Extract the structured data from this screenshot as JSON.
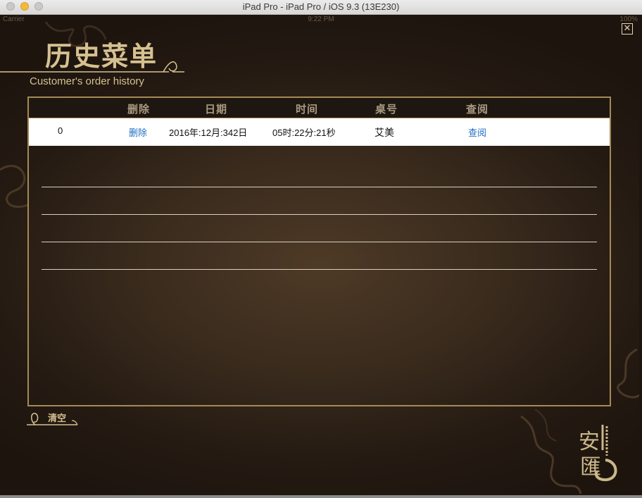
{
  "window": {
    "title": "iPad Pro - iPad Pro / iOS 9.3 (13E230)"
  },
  "status_bar": {
    "carrier": "Carrier",
    "time": "9:22 PM",
    "battery": "100%"
  },
  "page": {
    "title_cn": "历史菜单",
    "title_en": "Customer's order history",
    "close_icon": "close-icon"
  },
  "table": {
    "headers": [
      "删除",
      "日期",
      "时间",
      "桌号",
      "查阅"
    ],
    "rows": [
      {
        "index": "0",
        "delete": "删除",
        "date": "2016年:12月:342日",
        "time": "05时:22分:21秒",
        "table_no": "艾美",
        "view": "查阅"
      }
    ]
  },
  "footer": {
    "clear_label": "清空"
  },
  "colors": {
    "gold": "#d6c190",
    "frame": "#a58a55",
    "link": "#1f6fc1",
    "background": "#1e1510"
  }
}
